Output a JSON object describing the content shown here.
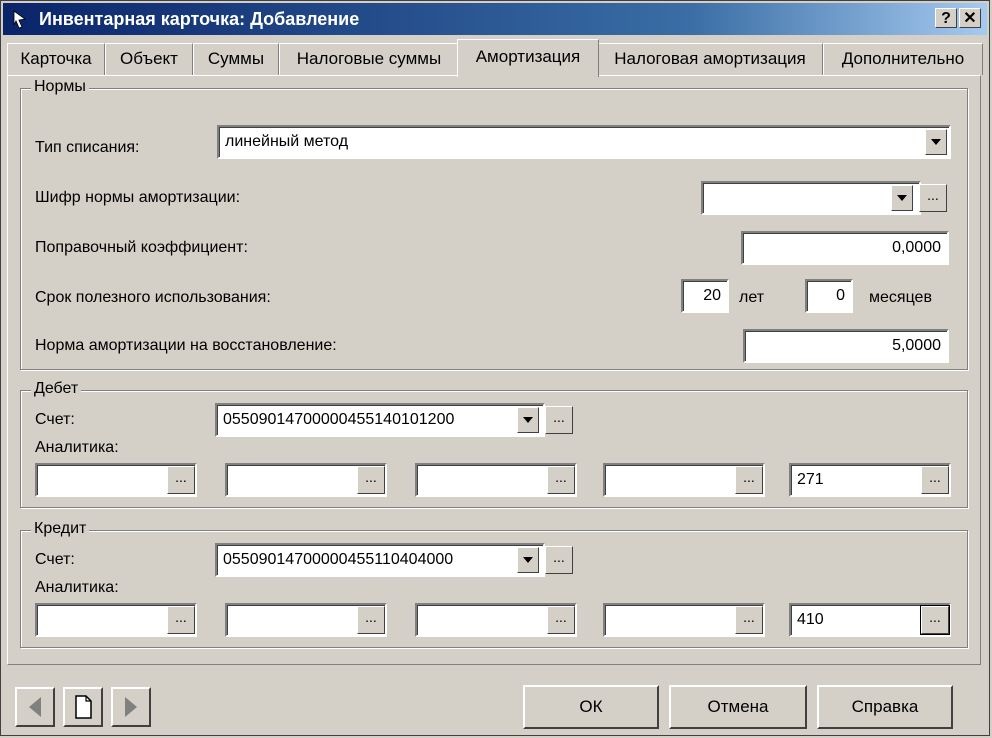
{
  "window": {
    "title": "Инвентарная карточка: Добавление",
    "help_label": "?",
    "close_label": "✕"
  },
  "tabs": [
    {
      "label": "Карточка"
    },
    {
      "label": "Объект"
    },
    {
      "label": "Суммы"
    },
    {
      "label": "Налоговые суммы"
    },
    {
      "label": "Амортизация",
      "active": true
    },
    {
      "label": "Налоговая амортизация"
    },
    {
      "label": "Дополнительно"
    }
  ],
  "norms": {
    "legend": "Нормы",
    "write_off_type_label": "Тип списания:",
    "write_off_type_value": "линейный метод",
    "norm_code_label": "Шифр нормы амортизации:",
    "norm_code_value": "",
    "correction_label": "Поправочный коэффициент:",
    "correction_value": "0,0000",
    "useful_life_label": "Срок полезного использования:",
    "years_value": "20",
    "years_unit": "лет",
    "months_value": "0",
    "months_unit": "месяцев",
    "restoration_label": "Норма амортизации на восстановление:",
    "restoration_value": "5,0000"
  },
  "debit": {
    "legend": "Дебет",
    "account_label": "Счет:",
    "account_value": "05509014700000455140101200",
    "analytics_label": "Аналитика:",
    "analytics": [
      "",
      "",
      "",
      "",
      "271"
    ]
  },
  "credit": {
    "legend": "Кредит",
    "account_label": "Счет:",
    "account_value": "05509014700000455110404000",
    "analytics_label": "Аналитика:",
    "analytics": [
      "",
      "",
      "",
      "",
      "410"
    ]
  },
  "ellipsis": "...",
  "footer": {
    "ok_label": "ОК",
    "cancel_label": "Отмена",
    "help_label": "Справка"
  }
}
